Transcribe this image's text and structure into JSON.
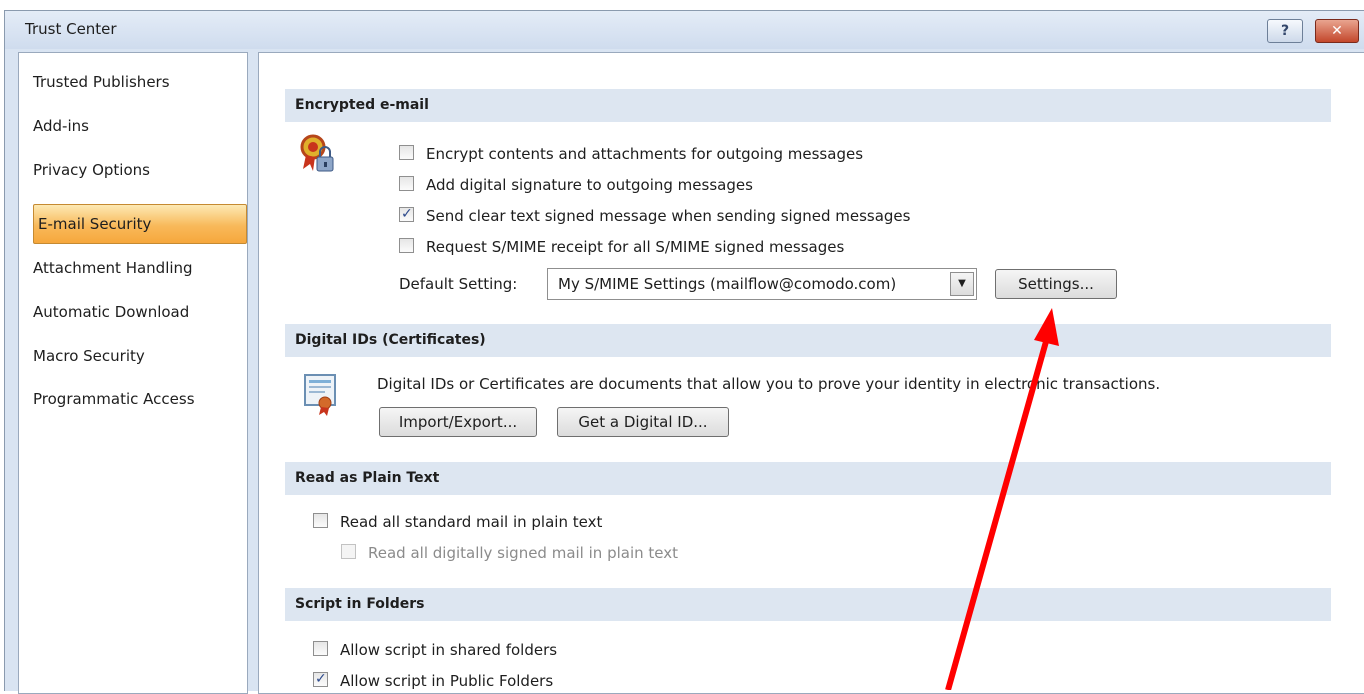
{
  "window": {
    "title": "Trust Center",
    "help_label": "?",
    "close_label": "✕"
  },
  "sidebar": {
    "items": [
      {
        "label": "Trusted Publishers"
      },
      {
        "label": "Add-ins"
      },
      {
        "label": "Privacy Options"
      },
      {
        "label": "E-mail Security",
        "selected": true
      },
      {
        "label": "Attachment Handling"
      },
      {
        "label": "Automatic Download"
      },
      {
        "label": "Macro Security"
      },
      {
        "label": "Programmatic Access"
      }
    ]
  },
  "encrypted": {
    "header": "Encrypted e-mail",
    "icon": "certificate-lock-icon",
    "options": [
      {
        "label": "Encrypt contents and attachments for outgoing messages",
        "checked": false
      },
      {
        "label": "Add digital signature to outgoing messages",
        "checked": false
      },
      {
        "label": "Send clear text signed message when sending signed messages",
        "checked": true
      },
      {
        "label": "Request S/MIME receipt for all S/MIME signed messages",
        "checked": false
      }
    ],
    "default_setting_label": "Default Setting:",
    "default_setting_value": "My S/MIME Settings (mailflow@comodo.com)",
    "settings_button": "Settings..."
  },
  "digital_ids": {
    "header": "Digital IDs (Certificates)",
    "icon": "certificate-icon",
    "description": "Digital IDs or Certificates are documents that allow you to prove your identity in electronic transactions.",
    "import_export_button": "Import/Export...",
    "get_id_button": "Get a Digital ID..."
  },
  "plain_text": {
    "header": "Read as Plain Text",
    "read_all_label": "Read all standard mail in plain text",
    "read_all_checked": false,
    "read_signed_label": "Read all digitally signed mail in plain text",
    "read_signed_checked": false
  },
  "script_folders": {
    "header": "Script in Folders",
    "shared_label": "Allow script in shared folders",
    "shared_checked": false,
    "public_label": "Allow script in Public Folders",
    "public_checked": true
  },
  "annotation": {
    "color": "#ff0000"
  }
}
